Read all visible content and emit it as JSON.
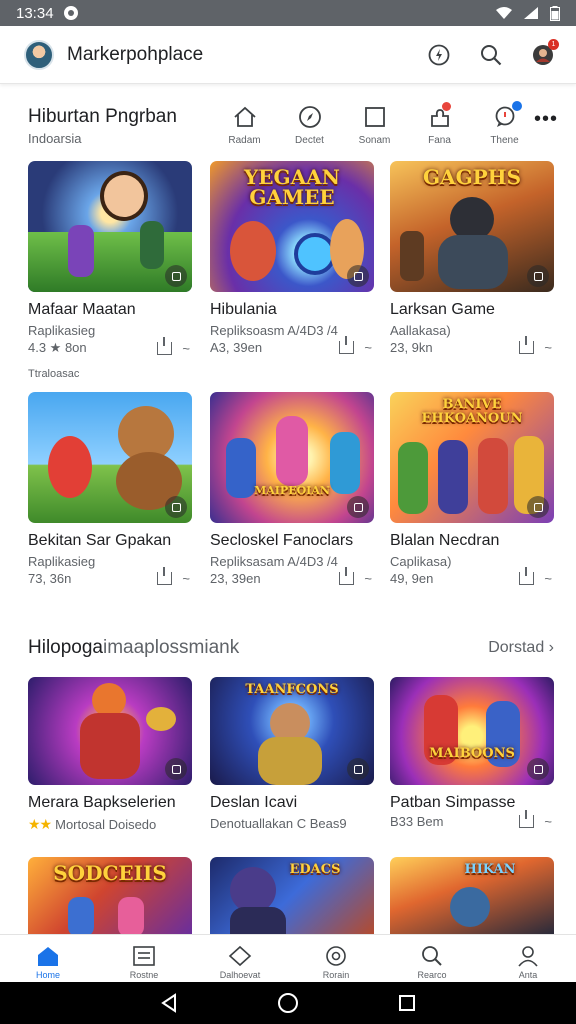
{
  "status_bar": {
    "time": "13:34"
  },
  "app_bar": {
    "title": "Markerpohplace"
  },
  "section1": {
    "title": "Hiburtan Pngrban",
    "subtitle": "Indoarsia",
    "categories": [
      {
        "label": "Radam",
        "icon": "home-icon"
      },
      {
        "label": "Dectet",
        "icon": "compass-icon"
      },
      {
        "label": "Sonam",
        "icon": "square-icon"
      },
      {
        "label": "Fana",
        "icon": "puzzle-icon"
      },
      {
        "label": "Thene",
        "icon": "chat-icon"
      }
    ],
    "more_label": "•••"
  },
  "cards_row1": [
    {
      "title": "Mafaar Maatan",
      "subtitle": "Raplikasieg",
      "rating": "4.3 ★ 8on",
      "banner": "",
      "extra": "Ttraloasac"
    },
    {
      "title": "Hibulania",
      "subtitle": "Repliksoasm A/4D3 /4",
      "rating": "A3, 39en",
      "banner": "YEGAAN GAMEE"
    },
    {
      "title": "Larksan Game",
      "subtitle": "Aallakasa)",
      "rating": "23, 9kn",
      "banner": "GAGPHS"
    }
  ],
  "cards_row2": [
    {
      "title": "Bekitan Sar Gpakan",
      "subtitle": "Raplikasieg",
      "rating": "73, 36n",
      "banner": ""
    },
    {
      "title": "Secloskel Fanoclars",
      "subtitle": "Repliksasam A/4D3 /4",
      "rating": "23, 39en",
      "banner": "MAIPEOIAN"
    },
    {
      "title": "Blalan Necdran",
      "subtitle": "Caplikasa)",
      "rating": "49, 9en",
      "banner": "BANIVE EHKOANOUN"
    }
  ],
  "section2": {
    "title_main": "Hilopoga",
    "title_fade": "imaaplossmiank",
    "link": "Dorstad"
  },
  "cards_row3": [
    {
      "title": "Merara Bapkselerien",
      "rating_text": "Mortosal Doisedo",
      "banner": ""
    },
    {
      "title": "Deslan Icavi",
      "rating_text": "Denotuallakan C Beas9",
      "banner": "TAANFCONS"
    },
    {
      "title": "Patban Simpasse",
      "rating_text": "B33 Bem",
      "banner": "MAIBOONS"
    }
  ],
  "cards_row4": [
    {
      "banner": "SODCEIIS"
    },
    {
      "banner": "EDACS"
    },
    {
      "banner": "HIKAN"
    }
  ],
  "bottom_nav": [
    {
      "label": "Home",
      "icon": "home-icon",
      "active": true
    },
    {
      "label": "Rostne",
      "icon": "list-icon"
    },
    {
      "label": "Dalhoevat",
      "icon": "tag-icon"
    },
    {
      "label": "Rorain",
      "icon": "circle-icon"
    },
    {
      "label": "Rearco",
      "icon": "search-icon"
    },
    {
      "label": "Anta",
      "icon": "person-icon"
    }
  ]
}
